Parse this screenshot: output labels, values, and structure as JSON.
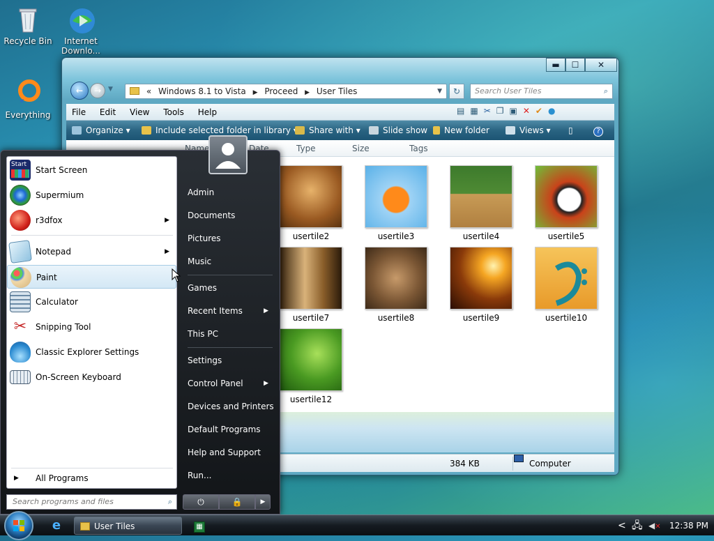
{
  "desktop": {
    "icons": [
      {
        "label": "Recycle Bin",
        "icon": "recycle-bin-icon"
      },
      {
        "label": "Internet Downlo...",
        "icon": "download-manager-icon"
      },
      {
        "label": "Everything",
        "icon": "everything-search-icon"
      }
    ]
  },
  "explorer": {
    "title_buttons": {
      "minimize": "▬",
      "maximize": "☐",
      "close": "✕"
    },
    "address": {
      "prefix": "«",
      "path": [
        "Windows 8.1 to Vista",
        "Proceed",
        "User Tiles"
      ]
    },
    "search_placeholder": "Search User Tiles",
    "menu": [
      "File",
      "Edit",
      "View",
      "Tools",
      "Help"
    ],
    "commands": {
      "organize": "Organize",
      "include": "Include selected folder in library",
      "share": "Share with",
      "slideshow": "Slide show",
      "newfolder": "New folder",
      "views": "Views"
    },
    "columns": [
      "Name",
      "Date",
      "Type",
      "Size",
      "Tags"
    ],
    "files": [
      "usertile2",
      "usertile3",
      "usertile4",
      "usertile5",
      "usertile7",
      "usertile8",
      "usertile9",
      "usertile10",
      "usertile12"
    ],
    "status": {
      "size": "384 KB",
      "location": "Computer"
    }
  },
  "start_menu": {
    "programs": [
      {
        "label": "Start Screen",
        "arrow": ""
      },
      {
        "label": "Supermium",
        "arrow": ""
      },
      {
        "label": "r3dfox",
        "arrow": "▶"
      },
      {
        "label": "Notepad",
        "arrow": "▶"
      },
      {
        "label": "Paint",
        "arrow": ""
      },
      {
        "label": "Calculator",
        "arrow": ""
      },
      {
        "label": "Snipping Tool",
        "arrow": ""
      },
      {
        "label": "Classic Explorer Settings",
        "arrow": ""
      },
      {
        "label": "On-Screen Keyboard",
        "arrow": ""
      }
    ],
    "start_icon_text": "Start",
    "all_programs": "All Programs",
    "search_placeholder": "Search programs and files",
    "right": [
      {
        "label": "Admin",
        "arrow": ""
      },
      {
        "label": "Documents",
        "arrow": ""
      },
      {
        "label": "Pictures",
        "arrow": ""
      },
      {
        "label": "Music",
        "arrow": ""
      },
      {
        "label": "Games",
        "arrow": ""
      },
      {
        "label": "Recent Items",
        "arrow": "▶"
      },
      {
        "label": "This PC",
        "arrow": ""
      },
      {
        "label": "Settings",
        "arrow": ""
      },
      {
        "label": "Control Panel",
        "arrow": "▶"
      },
      {
        "label": "Devices and Printers",
        "arrow": ""
      },
      {
        "label": "Default Programs",
        "arrow": ""
      },
      {
        "label": "Help and Support",
        "arrow": ""
      },
      {
        "label": "Run...",
        "arrow": ""
      }
    ],
    "power": {
      "shutdown": "⏻",
      "lock": "🔒",
      "more": "▶"
    }
  },
  "taskbar": {
    "window_button": "User Tiles",
    "tray_arrow": "<",
    "clock": "12:38 PM"
  }
}
